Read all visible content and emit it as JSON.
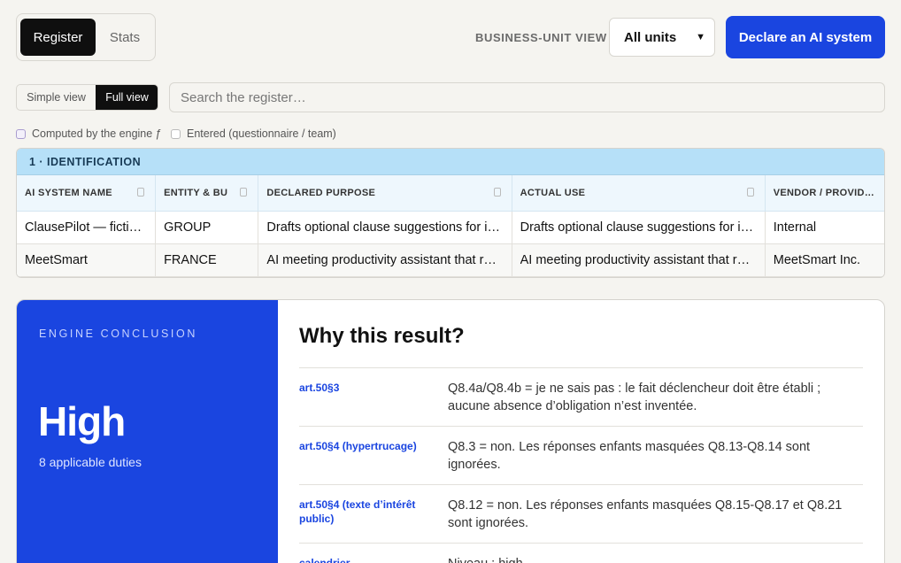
{
  "tabs": [
    {
      "label": "Register",
      "active": true
    },
    {
      "label": "Stats",
      "active": false
    }
  ],
  "business_unit": {
    "label": "BUSINESS-UNIT VIEW",
    "selected": "All units"
  },
  "declare_button": "Declare an AI system",
  "view_toggle": {
    "simple": "Simple view",
    "full": "Full view",
    "active": "full"
  },
  "search": {
    "placeholder": "Search the register…",
    "value": ""
  },
  "legend": {
    "computed": "Computed by the engine ƒ",
    "entered": "Entered (questionnaire / team)"
  },
  "table": {
    "section": "1 · IDENTIFICATION",
    "columns": [
      "AI SYSTEM NAME",
      "ENTITY & BU",
      "DECLARED PURPOSE",
      "ACTUAL USE",
      "VENDOR / PROVIDER"
    ],
    "rows": [
      [
        "ClausePilot — fictional",
        "GROUP",
        "Drafts optional clause suggestions for internal review",
        "Drafts optional clause suggestions for internal review",
        "Internal"
      ],
      [
        "MeetSmart",
        "FRANCE",
        "AI meeting productivity assistant that records and summarises",
        "AI meeting productivity assistant that records and summarises",
        "MeetSmart Inc."
      ]
    ]
  },
  "conclusion": {
    "eyebrow": "ENGINE CONCLUSION",
    "level": "High",
    "duties": "8 applicable duties",
    "why_title": "Why this result?",
    "reasons": [
      {
        "article": "art.50§3",
        "text": "Q8.4a/Q8.4b = je ne sais pas : le fait déclencheur doit être établi ; aucune absence d’obligation n’est inventée."
      },
      {
        "article": "art.50§4 (hypertrucage)",
        "text": "Q8.3 = non. Les réponses enfants masquées Q8.13-Q8.14 sont ignorées."
      },
      {
        "article": "art.50§4 (texte d’intérêt public)",
        "text": "Q8.12 = non. Les réponses enfants masquées Q8.15-Q8.17 et Q8.21 sont ignorées."
      },
      {
        "article": "calendrier",
        "text": "Niveau : high."
      }
    ]
  },
  "colors": {
    "accent": "#1a45e0",
    "dark": "#0f0f0f",
    "section_bg": "#b6e0f8",
    "page_bg": "#f5f4f0"
  }
}
